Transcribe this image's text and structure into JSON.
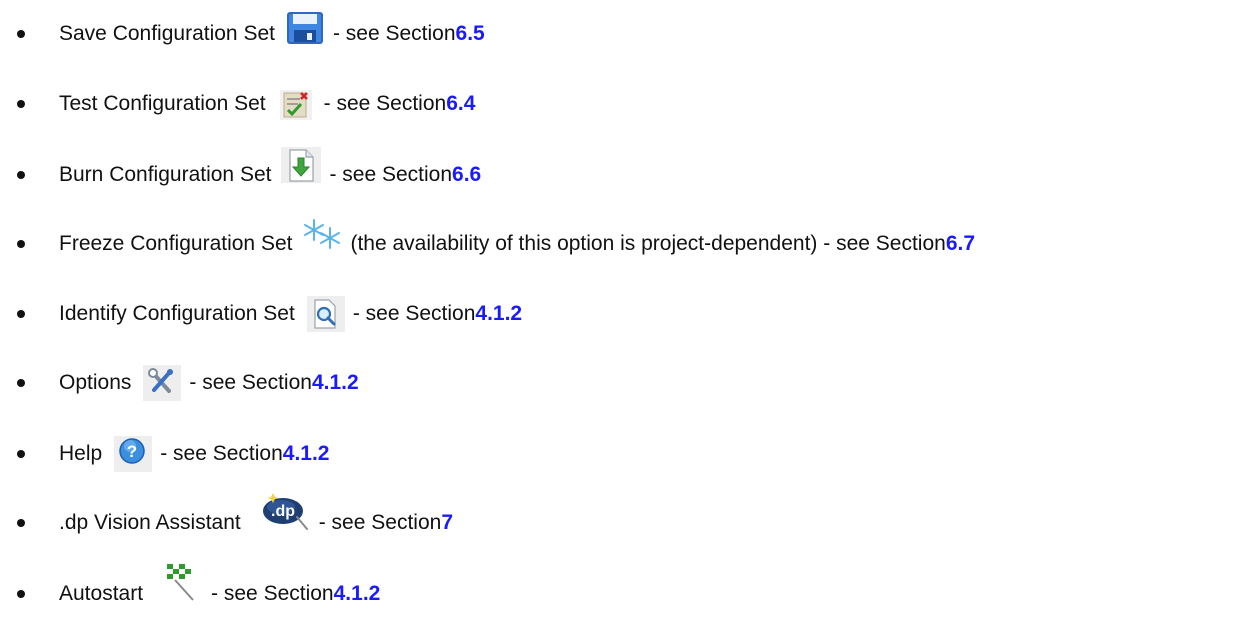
{
  "items": [
    {
      "label": "Save Configuration Set",
      "icon": "floppy-disk-icon",
      "mid": " - see Section ",
      "ref": "6.5",
      "after": ""
    },
    {
      "label": "Test Configuration Set",
      "icon": "test-checklist-icon",
      "mid": " - see Section ",
      "ref": "6.4",
      "after": ""
    },
    {
      "label": "Burn Configuration Set",
      "icon": "burn-download-icon",
      "mid": " - see Section ",
      "ref": "6.6",
      "after": ""
    },
    {
      "label": "Freeze Configuration Set",
      "icon": "snowflake-icon",
      "mid": " (the availability of this option is project-dependent) - see Section ",
      "ref": "6.7",
      "after": ""
    },
    {
      "label": "Identify Configuration Set",
      "icon": "magnifier-document-icon",
      "mid": " - see Section ",
      "ref": "4.1.2",
      "after": ""
    },
    {
      "label": "Options",
      "icon": "tools-icon",
      "mid": " - see Section ",
      "ref": "4.1.2",
      "after": ""
    },
    {
      "label": "Help",
      "icon": "help-question-icon",
      "mid": " - see Section ",
      "ref": "4.1.2",
      "after": ""
    },
    {
      "label": ".dp Vision Assistant",
      "icon": "dp-vision-assistant-icon",
      "mid": " - see Section ",
      "ref": "7",
      "after": ""
    },
    {
      "label": "Autostart",
      "icon": "checkered-flag-icon",
      "mid": " - see Section ",
      "ref": "4.1.2",
      "after": ""
    }
  ],
  "colors": {
    "text": "#111111",
    "link": "#1a1aff"
  }
}
